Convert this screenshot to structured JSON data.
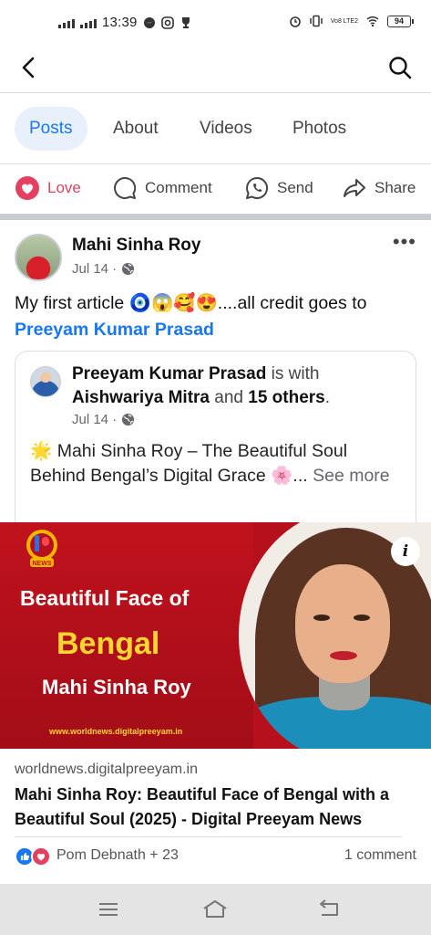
{
  "status_bar": {
    "time": "13:39",
    "battery": "94",
    "volte": "Vo8 LTE2"
  },
  "tabs": [
    {
      "label": "Posts"
    },
    {
      "label": "About"
    },
    {
      "label": "Videos"
    },
    {
      "label": "Photos"
    }
  ],
  "actions": {
    "love": "Love",
    "comment": "Comment",
    "send": "Send",
    "share": "Share"
  },
  "post": {
    "author": "Mahi Sinha Roy",
    "date": "Jul 14 ·",
    "text": "My first article 🧿😱🥰😍....all credit goes to",
    "mention": "Preeyam Kumar Prasad"
  },
  "shared": {
    "author": "Preeyam Kumar Prasad",
    "with_text": "is with",
    "tagged": "Aishwariya Mitra",
    "and_text": "and",
    "others": "15 others",
    "period": ".",
    "date": "Jul 14 ·",
    "text": "🌟 Mahi Sinha Roy – The Beautiful Soul Behind Bengal’s Digital Grace 🌸...",
    "see_more": "See more"
  },
  "banner": {
    "logo_badge": "NEWS",
    "line1": "Beautiful Face of",
    "line2": "Bengal",
    "line3": "Mahi Sinha Roy",
    "url": "www.worldnews.digitalpreeyam.in",
    "info": "i"
  },
  "link": {
    "domain": "worldnews.digitalpreeyam.in",
    "title": "Mahi Sinha Roy: Beautiful Face of Bengal with a Beautiful Soul (2025) - Digital Preeyam News"
  },
  "reactions": {
    "names": "Pom Debnath + 23",
    "comments": "1 comment"
  },
  "colors": {
    "accent": "#1877f2",
    "love": "#e4405f",
    "banner_red": "#b5101b",
    "banner_yellow": "#ffd531"
  }
}
